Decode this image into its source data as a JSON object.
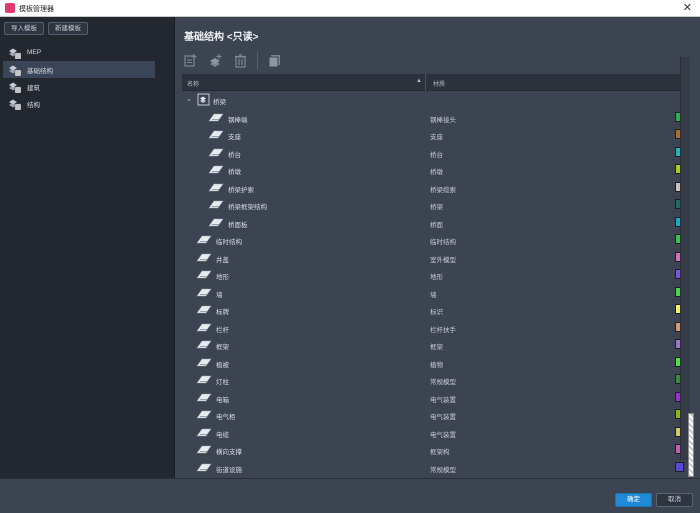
{
  "window": {
    "title": "模板管理器",
    "close": "✕"
  },
  "sidebar": {
    "import_button": "导入模板",
    "new_button": "新建模板",
    "items": [
      {
        "label": "MEP",
        "selected": false
      },
      {
        "label": "基础结构",
        "selected": true
      },
      {
        "label": "建筑",
        "selected": false
      },
      {
        "label": "结构",
        "selected": false
      }
    ]
  },
  "main": {
    "heading": "基础结构 <只读>",
    "toolbar": [
      "add-template-icon",
      "add-sub-icon",
      "delete-icon",
      "copy-icon"
    ],
    "table": {
      "col_name": "名称",
      "col_material": "材质",
      "sort_glyph": "▲",
      "rows": [
        {
          "name": "桥梁",
          "material": "",
          "level": 0,
          "group": true,
          "expanded": true,
          "color": ""
        },
        {
          "name": "钢棒端",
          "material": "钢棒接头",
          "level": 2,
          "color": "#2db34a"
        },
        {
          "name": "支座",
          "material": "支座",
          "level": 2,
          "color": "#b06a2c"
        },
        {
          "name": "桥台",
          "material": "桥台",
          "level": 2,
          "color": "#1fb7b0"
        },
        {
          "name": "桥墩",
          "material": "桥墩",
          "level": 2,
          "color": "#a6d11e"
        },
        {
          "name": "桥梁护索",
          "material": "桥梁缆索",
          "level": 2,
          "color": "#c4c4b8"
        },
        {
          "name": "桥梁框架结构",
          "material": "桥架",
          "level": 2,
          "color": "#1d6b64"
        },
        {
          "name": "桥面板",
          "material": "桥面",
          "level": 2,
          "color": "#20a7c2"
        },
        {
          "name": "临时结构",
          "material": "临时结构",
          "level": 1,
          "color": "#3dc251"
        },
        {
          "name": "井盖",
          "material": "室外模型",
          "level": 1,
          "color": "#d370b8"
        },
        {
          "name": "地形",
          "material": "地形",
          "level": 1,
          "color": "#7a55e0"
        },
        {
          "name": "墙",
          "material": "墙",
          "level": 1,
          "color": "#4dd54a"
        },
        {
          "name": "标牌",
          "material": "标识",
          "level": 1,
          "color": "#f2f06a"
        },
        {
          "name": "栏杆",
          "material": "栏杆扶手",
          "level": 1,
          "color": "#d99a70"
        },
        {
          "name": "框架",
          "material": "框架",
          "level": 1,
          "color": "#9a7ac8"
        },
        {
          "name": "植被",
          "material": "植物",
          "level": 1,
          "color": "#4fe046"
        },
        {
          "name": "灯柱",
          "material": "常规模型",
          "level": 1,
          "color": "#3b8a3c"
        },
        {
          "name": "电箱",
          "material": "电气装置",
          "level": 1,
          "color": "#9b2fd6"
        },
        {
          "name": "电气柜",
          "material": "电气装置",
          "level": 1,
          "color": "#8ab61e"
        },
        {
          "name": "电缆",
          "material": "电气装置",
          "level": 1,
          "color": "#d8c65e"
        },
        {
          "name": "横向支撑",
          "material": "框架构",
          "level": 1,
          "color": "#c25eb0"
        },
        {
          "name": "街道设施",
          "material": "常规模型",
          "level": 1,
          "color": "#5b47d6"
        }
      ]
    }
  },
  "footer": {
    "ok": "确定",
    "cancel": "取消"
  },
  "colors": {
    "accent": "#1f8bd6",
    "selected_row": "#3a4658",
    "panel": "#3d4451",
    "sidebar": "#232830"
  }
}
